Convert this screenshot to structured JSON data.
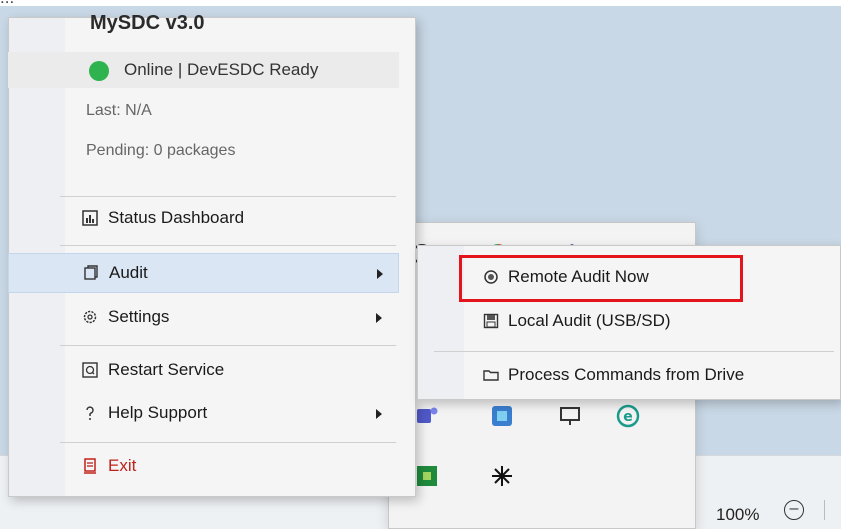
{
  "top_strip": {
    "text": "..."
  },
  "main_menu": {
    "title": "MySDC  v3.0",
    "status": {
      "text": "Online  |  DevESDC Ready",
      "color": "#2fb34f"
    },
    "last": "Last: N/A",
    "pending": "Pending: 0 packages",
    "items": [
      {
        "id": "status-dashboard",
        "label": "Status Dashboard",
        "icon": "bar-chart-icon",
        "glyph": "📊",
        "submenu": false
      },
      {
        "id": "audit",
        "label": "Audit",
        "icon": "audit-icon",
        "glyph": "🗐",
        "submenu": true
      },
      {
        "id": "settings",
        "label": "Settings",
        "icon": "gear-icon",
        "glyph": "⚙",
        "submenu": true
      },
      {
        "id": "restart-service",
        "label": "Restart Service",
        "icon": "restart-icon",
        "glyph": "⟳",
        "submenu": false
      },
      {
        "id": "help-support",
        "label": "Help  Support",
        "icon": "help-icon",
        "glyph": "?",
        "submenu": true
      },
      {
        "id": "exit",
        "label": "Exit",
        "icon": "exit-icon",
        "glyph": "▮",
        "submenu": false
      }
    ]
  },
  "audit_submenu": {
    "items": [
      {
        "label": "Remote Audit Now",
        "icon": "remote-audit-icon",
        "glyph": "◉"
      },
      {
        "label": "Local Audit (USB/SD)",
        "icon": "floppy-icon",
        "glyph": "▤"
      },
      {
        "label": "Process Commands from Drive",
        "icon": "folder-icon",
        "glyph": "🗀"
      }
    ],
    "highlight_color": "#e3141b"
  },
  "taskbar": {
    "zoom": "100%"
  }
}
